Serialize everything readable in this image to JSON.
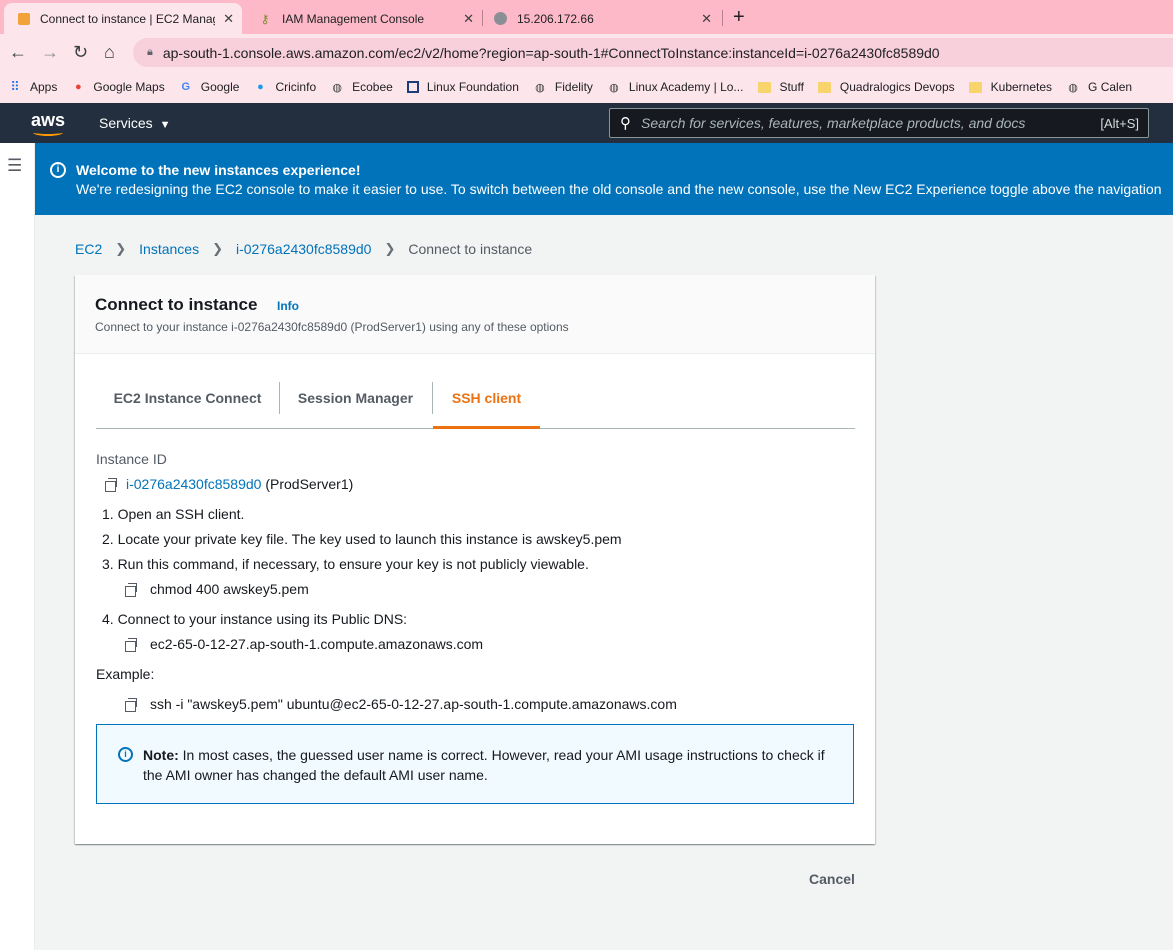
{
  "browser": {
    "tabs": [
      {
        "title": "Connect to instance | EC2 Manag",
        "active": true
      },
      {
        "title": "IAM Management Console",
        "active": false
      },
      {
        "title": "15.206.172.66",
        "active": false
      }
    ],
    "url": "ap-south-1.console.aws.amazon.com/ec2/v2/home?region=ap-south-1#ConnectToInstance:instanceId=i-0276a2430fc8589d0",
    "bookmarks": [
      "Apps",
      "Google Maps",
      "Google",
      "Cricinfo",
      "Ecobee",
      "Linux Foundation",
      "Fidelity",
      "Linux Academy | Lo...",
      "Stuff",
      "Quadralogics Devops",
      "Kubernetes",
      "G Calen"
    ]
  },
  "aws_nav": {
    "logo": "aws",
    "services_label": "Services",
    "search_placeholder": "Search for services, features, marketplace products, and docs",
    "search_shortcut": "[Alt+S]"
  },
  "banner": {
    "title": "Welcome to the new instances experience!",
    "body": "We're redesigning the EC2 console to make it easier to use. To switch between the old console and the new console, use the New EC2 Experience toggle above the navigation"
  },
  "breadcrumb": {
    "items": [
      "EC2",
      "Instances",
      "i-0276a2430fc8589d0"
    ],
    "current": "Connect to instance"
  },
  "card": {
    "title": "Connect to instance",
    "info": "Info",
    "subtitle": "Connect to your instance i-0276a2430fc8589d0 (ProdServer1) using any of these options",
    "tabs": [
      "EC2 Instance Connect",
      "Session Manager",
      "SSH client"
    ],
    "active_tab": "SSH client",
    "instance_id_label": "Instance ID",
    "instance_id": "i-0276a2430fc8589d0",
    "instance_name": "(ProdServer1)",
    "steps": [
      "1. Open an SSH client.",
      "2. Locate your private key file. The key used to launch this instance is awskey5.pem",
      "3. Run this command, if necessary, to ensure your key is not publicly viewable.",
      "4. Connect to your instance using its Public DNS:"
    ],
    "chmod_command": "chmod 400 awskey5.pem",
    "public_dns": "ec2-65-0-12-27.ap-south-1.compute.amazonaws.com",
    "example_label": "Example:",
    "example_command": "ssh -i \"awskey5.pem\" ubuntu@ec2-65-0-12-27.ap-south-1.compute.amazonaws.com",
    "note_label": "Note:",
    "note_text": "In most cases, the guessed user name is correct. However, read your AMI usage instructions to check if the AMI owner has changed the default AMI user name."
  },
  "cancel_label": "Cancel"
}
